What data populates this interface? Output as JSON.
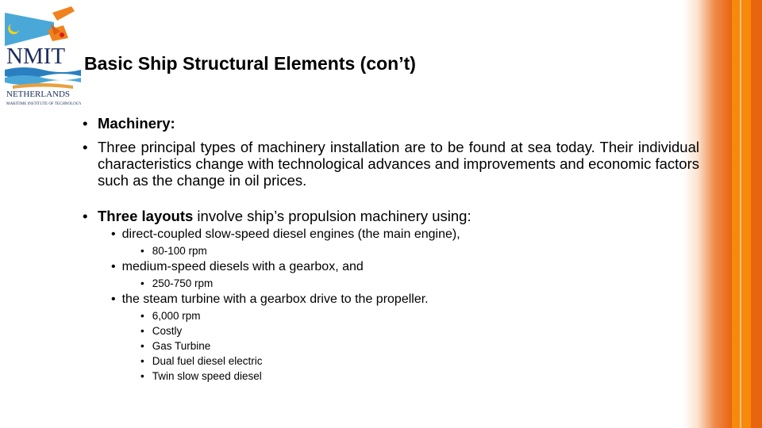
{
  "logo": {
    "name": "NMIT",
    "subtitle": "NETHERLANDS",
    "tagline": "MARITIME INSTITUTE OF TECHNOLOGY"
  },
  "title": "Basic Ship Structural Elements (con’t)",
  "bullets": {
    "machinery": "Machinery:",
    "principal": "Three principal types of machinery installation are to be found at sea today. Their individual characteristics change with technological advances and improvements and economic factors such as the change in oil prices.",
    "layouts_bold": "Three layouts",
    "layouts_rest": " involve ship’s propulsion machinery using:",
    "sub": [
      {
        "text": "direct-coupled slow-speed diesel engines (the main engine),",
        "items": [
          "80-100 rpm"
        ]
      },
      {
        "text": "medium-speed diesels with a gearbox, and",
        "items": [
          "250-750 rpm"
        ]
      },
      {
        "text": "the steam turbine with a gearbox drive to the propeller.",
        "items": [
          "6,000 rpm",
          "Costly",
          "Gas Turbine",
          "Dual fuel diesel electric",
          "Twin slow speed diesel"
        ]
      }
    ]
  },
  "colors": {
    "orange_dark": "#e8650f",
    "orange_bright": "#f7890b",
    "highlight": "#fbc07a"
  }
}
